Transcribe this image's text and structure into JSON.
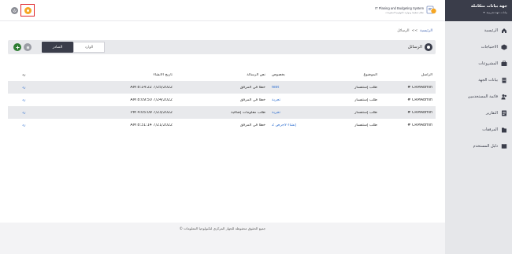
{
  "sidebar": {
    "org_name": "جهة بيانات متكاملة",
    "org_sub": "بيانات جهة تجريبية",
    "items": [
      {
        "label": "الرئيسية",
        "icon": "home-icon"
      },
      {
        "label": "الاحتياجات",
        "icon": "cube-icon"
      },
      {
        "label": "المشروعات",
        "icon": "projects-icon"
      },
      {
        "label": "بيانات الجهة",
        "icon": "building-icon"
      },
      {
        "label": "قائمة المستخدمين",
        "icon": "users-icon"
      },
      {
        "label": "التقارير",
        "icon": "reports-icon"
      },
      {
        "label": "المرفقات",
        "icon": "attachments-icon"
      },
      {
        "label": "دليل المستخدم",
        "icon": "book-icon"
      }
    ]
  },
  "header": {
    "system_title": "IT Planing and Budgeting System",
    "system_subtitle": "نظام تخطيط وموازنة تكنولوجيا المعلومات"
  },
  "breadcrumb": {
    "home": "الرئيسية",
    "separator": ">>",
    "current": "الرسائل"
  },
  "page": {
    "title": "الرسائل",
    "tabs": [
      {
        "label": "الوارد",
        "active": false
      },
      {
        "label": "الصادر",
        "active": true
      }
    ]
  },
  "table": {
    "headers": {
      "sender": "الراسل",
      "topic": "الموضوع",
      "regarding": "بخصوص",
      "text": "نص الرسالة",
      "date": "تاريخ الانشاء",
      "reply": "رد"
    },
    "rows": [
      {
        "sender": "CRMAdmin #",
        "topic": "طلب إستفسار",
        "regarding": "test",
        "text": "خطأ في المرفق",
        "date": "7/25/2022 8:14:22 AM",
        "reply": "رد"
      },
      {
        "sender": "CRMAdmin #",
        "topic": "طلب إستفسار",
        "regarding": "تجربة",
        "text": "خطأ في المرفق",
        "date": "7/24/2022 8:09:50 AM",
        "reply": "رد"
      },
      {
        "sender": "CRMAdmin #",
        "topic": "طلب إستفسار",
        "regarding": "تجربة",
        "text": "طلب معلومات إضافية",
        "date": "7/23/2022 4:05:09 PM",
        "reply": "رد"
      },
      {
        "sender": "CRMAdmin #",
        "topic": "طلب إستفسار",
        "regarding": "إنشاء لاجرص 2",
        "text": "خطأ في المرفق",
        "date": "7/21/2022 8:31:14 AM",
        "reply": "رد"
      }
    ]
  },
  "footer": {
    "text": "جميع الحقوق محفوظة للجهاز المركزي لتكنولوجيا المعلومات ©"
  },
  "colors": {
    "sidebar_dark": "#3a3d4a",
    "accent": "#f5a623",
    "link": "#2f6fd0",
    "add_green": "#2e7d32"
  }
}
